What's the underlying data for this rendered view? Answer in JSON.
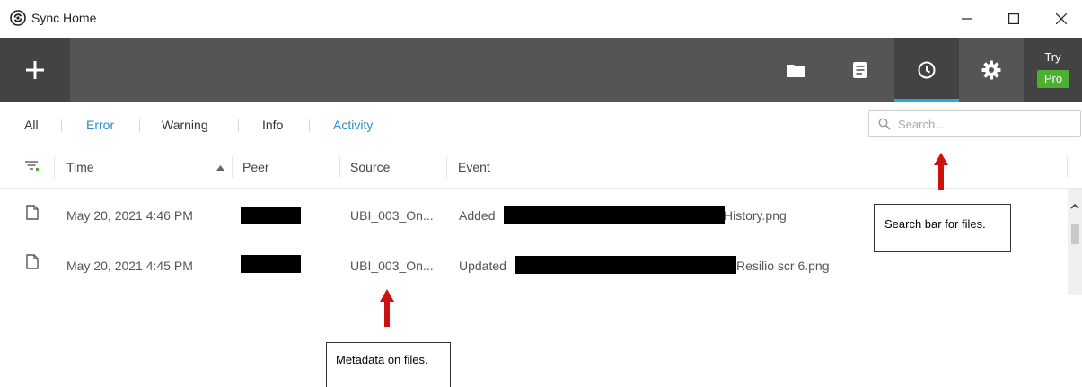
{
  "window": {
    "title": "Sync Home",
    "controls": [
      "minimize",
      "maximize",
      "close"
    ]
  },
  "toolbar": {
    "add_icon": "plus-icon",
    "buttons": [
      {
        "icon": "folder-icon"
      },
      {
        "icon": "document-list-icon"
      },
      {
        "icon": "clock-icon",
        "active": true
      },
      {
        "icon": "gear-icon"
      }
    ],
    "pro": {
      "try_label": "Try",
      "badge_label": "Pro"
    }
  },
  "filters": {
    "tabs": [
      {
        "label": "All"
      },
      {
        "label": "Error"
      },
      {
        "label": "Warning"
      },
      {
        "label": "Info"
      },
      {
        "label": "Activity"
      }
    ],
    "search_placeholder": "Search..."
  },
  "table": {
    "columns": [
      "Time",
      "Peer",
      "Source",
      "Event"
    ],
    "rows": [
      {
        "time": "May 20, 2021 4:46 PM",
        "source": "UBI_003_On...",
        "event_action": "Added",
        "event_file": "History.png"
      },
      {
        "time": "May 20, 2021 4:45 PM",
        "source": "UBI_003_On...",
        "event_action": "Updated",
        "event_file": "Resilio scr 6.png"
      }
    ]
  },
  "annotations": {
    "search_note": "Search bar for files.",
    "metadata_note": "Metadata on files."
  },
  "colors": {
    "toolbar_bg": "#555555",
    "accent_blue": "#2ba8d9",
    "pro_green": "#4caf2f",
    "annotation_red": "#cc1111"
  }
}
